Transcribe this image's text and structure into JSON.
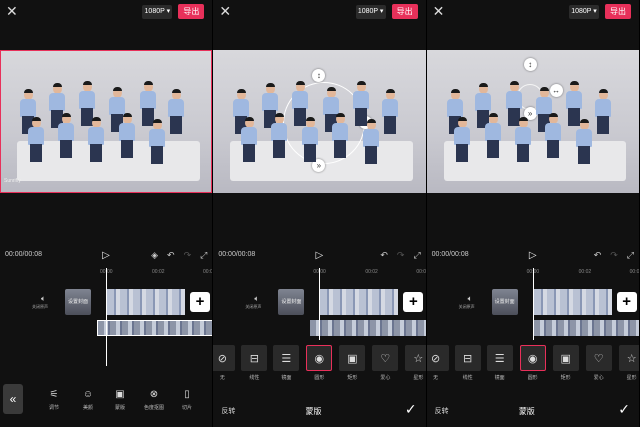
{
  "top": {
    "resolution": "1080P ▾",
    "export_label": "导出"
  },
  "time": {
    "display": "00:00/00:08"
  },
  "ruler": [
    "00:00",
    "00:02",
    "00:0"
  ],
  "track": {
    "audio_label": "关闭原声",
    "cover_label": "设置封面"
  },
  "panel1": {
    "watermark": "Sunriffy",
    "tools": [
      {
        "icon": "adjust-icon",
        "label": "调节"
      },
      {
        "icon": "beauty-icon",
        "label": "美颜"
      },
      {
        "icon": "mask-icon",
        "label": "蒙版"
      },
      {
        "icon": "chroma-icon",
        "label": "色度抠图"
      },
      {
        "icon": "anim-icon",
        "label": "切片"
      }
    ]
  },
  "masks": [
    {
      "label": "无",
      "icon": "⊘"
    },
    {
      "label": "线性",
      "icon": "⊟"
    },
    {
      "label": "镜面",
      "icon": "☰"
    },
    {
      "label": "圆形",
      "icon": "◉"
    },
    {
      "label": "矩形",
      "icon": "▣"
    },
    {
      "label": "爱心",
      "icon": "♡"
    },
    {
      "label": "星形",
      "icon": "☆"
    }
  ],
  "bottom": {
    "invert": "反转",
    "title": "蒙版"
  }
}
